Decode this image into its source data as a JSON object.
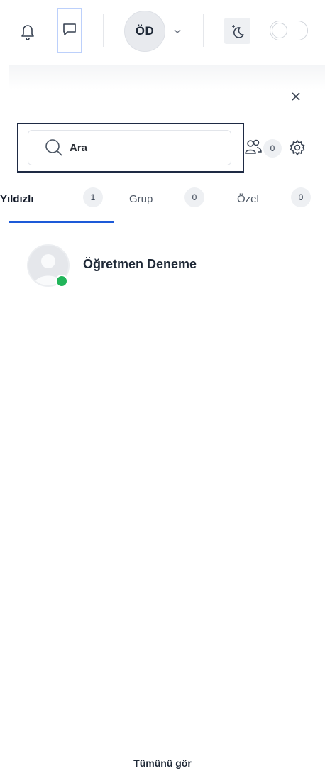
{
  "header": {
    "notifications_icon": "bell-icon",
    "messages_icon": "chat-bubble-icon",
    "user_initials": "ÖD",
    "user_menu_icon": "chevron-down-icon",
    "theme_icon": "moon-sparkle-icon",
    "toggle_state": "off"
  },
  "panel": {
    "close_icon": "close-icon",
    "search": {
      "placeholder": "Ara",
      "value": ""
    },
    "contacts_icon": "users-icon",
    "contact_requests_count": "0",
    "settings_icon": "gear-icon",
    "tabs": [
      {
        "label": "Yıldızlı",
        "count": "1",
        "active": true
      },
      {
        "label": "Grup",
        "count": "0",
        "active": false
      },
      {
        "label": "Özel",
        "count": "0",
        "active": false
      }
    ],
    "conversations": [
      {
        "name": "Öğretmen Deneme",
        "status": "online"
      }
    ],
    "see_all_label": "Tümünü gör"
  },
  "colors": {
    "accent": "#1d5ad8",
    "online": "#22b55a",
    "focus_outline": "#1e2a44",
    "badge_bg": "#eef0f3"
  }
}
